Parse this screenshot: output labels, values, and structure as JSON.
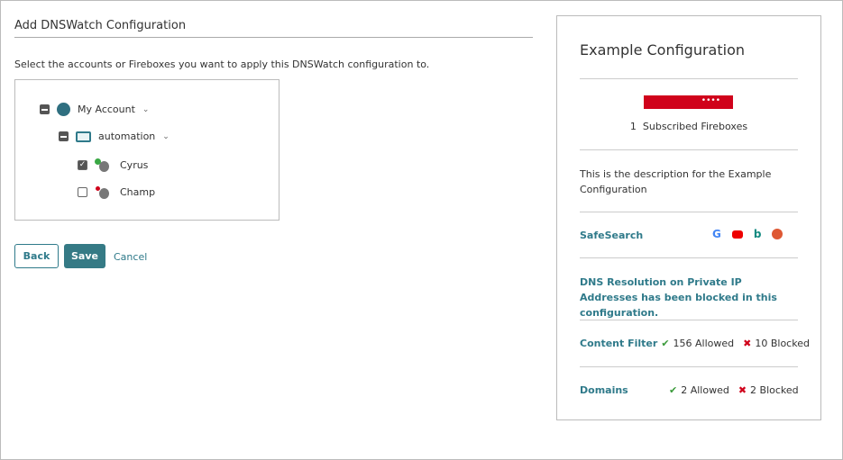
{
  "title": "Add DNSWatch Configuration",
  "intro": "Select the accounts or Fireboxes you want to apply this DNSWatch configuration to.",
  "tree": {
    "account": "My Account",
    "folder": "automation",
    "devices": [
      {
        "name": "Cyrus",
        "checked": true,
        "status": "online"
      },
      {
        "name": "Champ",
        "checked": false,
        "status": "error"
      }
    ]
  },
  "buttons": {
    "back": "Back",
    "save": "Save",
    "cancel": "Cancel"
  },
  "panel": {
    "title": "Example Configuration",
    "subscribed_count": "1",
    "subscribed_label": "Subscribed Fireboxes",
    "description": "This is the description for the Example Configuration",
    "safesearch": "SafeSearch",
    "dns_notice": "DNS Resolution on Private IP Addresses has been blocked in this configuration.",
    "content_filter": {
      "label": "Content Filter",
      "allowed": "156 Allowed",
      "blocked": "10 Blocked"
    },
    "domains": {
      "label": "Domains",
      "allowed": "2 Allowed",
      "blocked": "2 Blocked"
    }
  },
  "colors": {
    "teal": "#2f7a8a",
    "brand_red": "#d0021b"
  }
}
